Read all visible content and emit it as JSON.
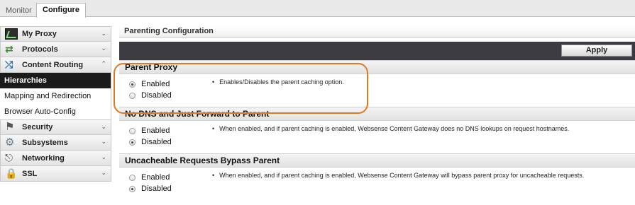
{
  "top_tabs": {
    "monitor": "Monitor",
    "configure": "Configure"
  },
  "sidebar": {
    "my_proxy": "My Proxy",
    "protocols": "Protocols",
    "content_routing": "Content Routing",
    "hierarchies": "Hierarchies",
    "mapping": "Mapping and Redirection",
    "browser_auto": "Browser Auto-Config",
    "security": "Security",
    "subsystems": "Subsystems",
    "networking": "Networking",
    "ssl": "SSL"
  },
  "main": {
    "title": "Parenting Configuration",
    "apply_label": "Apply",
    "sections": [
      {
        "heading": "Parent Proxy",
        "enabled_label": "Enabled",
        "disabled_label": "Disabled",
        "selected": "Enabled",
        "description": "Enables/Disables the parent caching option."
      },
      {
        "heading": "No DNS and Just Forward to Parent",
        "enabled_label": "Enabled",
        "disabled_label": "Disabled",
        "selected": "Disabled",
        "description": "When enabled, and if parent caching is enabled, Websense Content Gateway does no DNS lookups on request hostnames."
      },
      {
        "heading": "Uncacheable Requests Bypass Parent",
        "enabled_label": "Enabled",
        "disabled_label": "Disabled",
        "selected": "Disabled",
        "description": "When enabled, and if parent caching is enabled, Websense Content Gateway will bypass parent proxy for uncacheable requests."
      }
    ]
  },
  "colors": {
    "highlight": "#e07a22",
    "apply_bar": "#3b3b41",
    "active_item": "#1b1b1b"
  }
}
